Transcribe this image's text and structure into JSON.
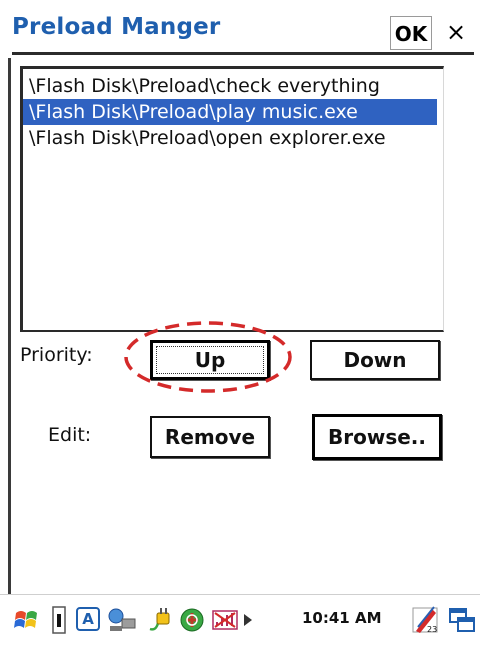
{
  "window": {
    "title": "Preload Manger",
    "ok_label": "OK",
    "close_label": "×"
  },
  "list": {
    "items": [
      "\\Flash Disk\\Preload\\check everything",
      "\\Flash Disk\\Preload\\play music.exe",
      "\\Flash Disk\\Preload\\open explorer.exe"
    ],
    "selected_index": 1
  },
  "priority": {
    "label": "Priority:",
    "up_label": "Up",
    "down_label": "Down"
  },
  "edit": {
    "label": "Edit:",
    "remove_label": "Remove",
    "browse_label": "Browse.."
  },
  "taskbar": {
    "time": "10:41 AM",
    "input_indicator": "A",
    "icons": [
      "start-flag-icon",
      "keyboard-toggle-icon",
      "input-mode-icon",
      "network-icon",
      "power-plug-icon",
      "sync-icon",
      "signal-icon",
      "volume-icon",
      "pen-calendar-icon",
      "switch-windows-icon"
    ]
  },
  "annotation": {
    "color": "#d42a2a"
  },
  "colors": {
    "title": "#1f5fae",
    "selection": "#2f62c1"
  }
}
